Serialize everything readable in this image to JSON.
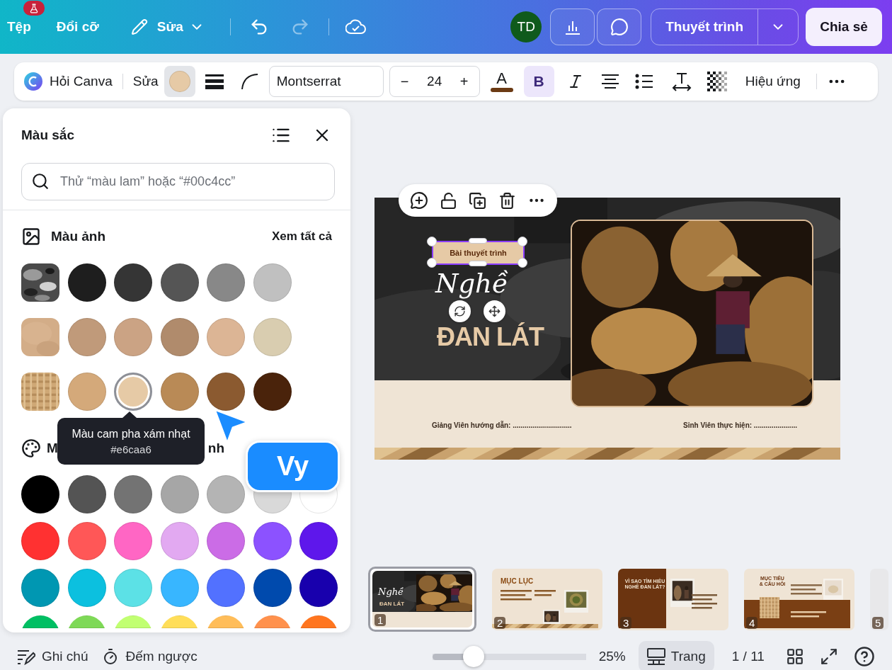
{
  "top_bar": {
    "file_menu": "Tệp",
    "resize": "Đổi cỡ",
    "edit_menu": "Sửa",
    "undo": {
      "disabled": false
    },
    "redo": {
      "disabled": true
    },
    "avatar": "TD",
    "present": "Thuyết trình",
    "share": "Chia sẻ"
  },
  "toolbar": {
    "ask": "Hỏi Canva",
    "edit": "Sửa",
    "fill": {
      "color": "#e6caa6",
      "active": true
    },
    "font": "Montserrat",
    "size_minus": "−",
    "size": "24",
    "size_plus": "+",
    "text_color": {
      "label": "A",
      "color": "#6b3a14"
    },
    "bold": {
      "label": "B",
      "active": true
    },
    "effects": "Hiệu ứng"
  },
  "color_panel": {
    "title": "Màu sắc",
    "search": {
      "placeholder": "Thử “màu lam” hoặc “#00c4cc”"
    },
    "photo_colors": {
      "title": "Màu ảnh",
      "see_all": "Xem tất cả",
      "swatches": [
        {
          "kind": "picture",
          "selected": false
        },
        {
          "kind": "color",
          "color": "#1e1e1e",
          "selected": false
        },
        {
          "kind": "color",
          "color": "#353535",
          "selected": false
        },
        {
          "kind": "color",
          "color": "#555555",
          "selected": false
        },
        {
          "kind": "color",
          "color": "#888888",
          "selected": false
        },
        {
          "kind": "color",
          "color": "#c0c0c0",
          "selected": false
        },
        {
          "kind": "picture",
          "selected": false
        },
        {
          "kind": "color",
          "color": "#c09a7a",
          "selected": false
        },
        {
          "kind": "color",
          "color": "#cba384",
          "selected": false
        },
        {
          "kind": "color",
          "color": "#b08b6c",
          "selected": false
        },
        {
          "kind": "color",
          "color": "#dcb595",
          "selected": false
        },
        {
          "kind": "color",
          "color": "#d9cdb0",
          "selected": false
        },
        {
          "kind": "picture",
          "selected": false
        },
        {
          "kind": "color",
          "color": "#d4a97a",
          "selected": false
        },
        {
          "kind": "color",
          "color": "#e6caa6",
          "selected": true
        },
        {
          "kind": "color",
          "color": "#b98a56",
          "selected": false
        },
        {
          "kind": "color",
          "color": "#8b5a30",
          "selected": false
        },
        {
          "kind": "color",
          "color": "#4a230b",
          "selected": false
        }
      ]
    },
    "default_colors": {
      "title_start": "M",
      "title_end": "nh",
      "swatches": [
        {
          "color": "#000000",
          "selected": false
        },
        {
          "color": "#545454",
          "selected": false
        },
        {
          "color": "#737373",
          "selected": false
        },
        {
          "color": "#a6a6a6",
          "selected": false
        },
        {
          "color": "#b4b4b4",
          "selected": false
        },
        {
          "color": "#d9d9d9",
          "selected": false
        },
        {
          "color": "#ffffff",
          "selected": false
        },
        {
          "color": "#ff3131",
          "selected": false
        },
        {
          "color": "#ff5757",
          "selected": false
        },
        {
          "color": "#ff66c4",
          "selected": false
        },
        {
          "color": "#e2a9f1",
          "selected": false
        },
        {
          "color": "#cb6ce6",
          "selected": false
        },
        {
          "color": "#8c52ff",
          "selected": false
        },
        {
          "color": "#5e17eb",
          "selected": false
        },
        {
          "color": "#0097b2",
          "selected": false
        },
        {
          "color": "#0cc0df",
          "selected": false
        },
        {
          "color": "#5ce1e6",
          "selected": false
        },
        {
          "color": "#38b6ff",
          "selected": false
        },
        {
          "color": "#5271ff",
          "selected": false
        },
        {
          "color": "#004aad",
          "selected": false
        },
        {
          "color": "#1800ad",
          "selected": false
        },
        {
          "color": "#00bf63",
          "selected": false
        },
        {
          "color": "#7ed957",
          "selected": false
        },
        {
          "color": "#c1ff72",
          "selected": false
        },
        {
          "color": "#ffde59",
          "selected": false
        },
        {
          "color": "#ffbd59",
          "selected": false
        },
        {
          "color": "#ff914d",
          "selected": false
        },
        {
          "color": "#ff751f",
          "selected": false
        }
      ]
    },
    "tooltip": {
      "name": "Màu cam pha xám nhạt",
      "hex": "#e6caa6"
    }
  },
  "collaborator": {
    "name": "Vy",
    "color": "#1a8cff"
  },
  "slide": {
    "tag": "Bài thuyết trình",
    "script_title": "Nghề",
    "title": "ĐAN LÁT",
    "lecturer": "Giảng Viên hướng dẫn: ..............................",
    "student": "Sinh Viên thực hiện: ......................"
  },
  "thumbnails": [
    {
      "kind": "cover",
      "number": "1",
      "selected": true,
      "title": "Nghề",
      "subtitle": "ĐAN LÁT"
    },
    {
      "kind": "toc",
      "number": "2",
      "selected": false,
      "title": "MỤC LỤC"
    },
    {
      "kind": "split",
      "number": "3",
      "selected": false,
      "title": "VÌ SAO TÌM HIỂU NGHỀ ĐAN LÁT?"
    },
    {
      "kind": "goals",
      "number": "4",
      "selected": false,
      "title": "MỤC TIÊU & CÂU HỎI"
    },
    {
      "kind": "edge",
      "number": "5",
      "selected": false
    }
  ],
  "bottom_bar": {
    "notes": "Ghi chú",
    "timer": "Đếm ngược",
    "zoom": {
      "level": 0.27
    },
    "zoom_reading": "25%",
    "view": {
      "label": "Trang",
      "active": true
    },
    "pages": "1 / 11"
  }
}
